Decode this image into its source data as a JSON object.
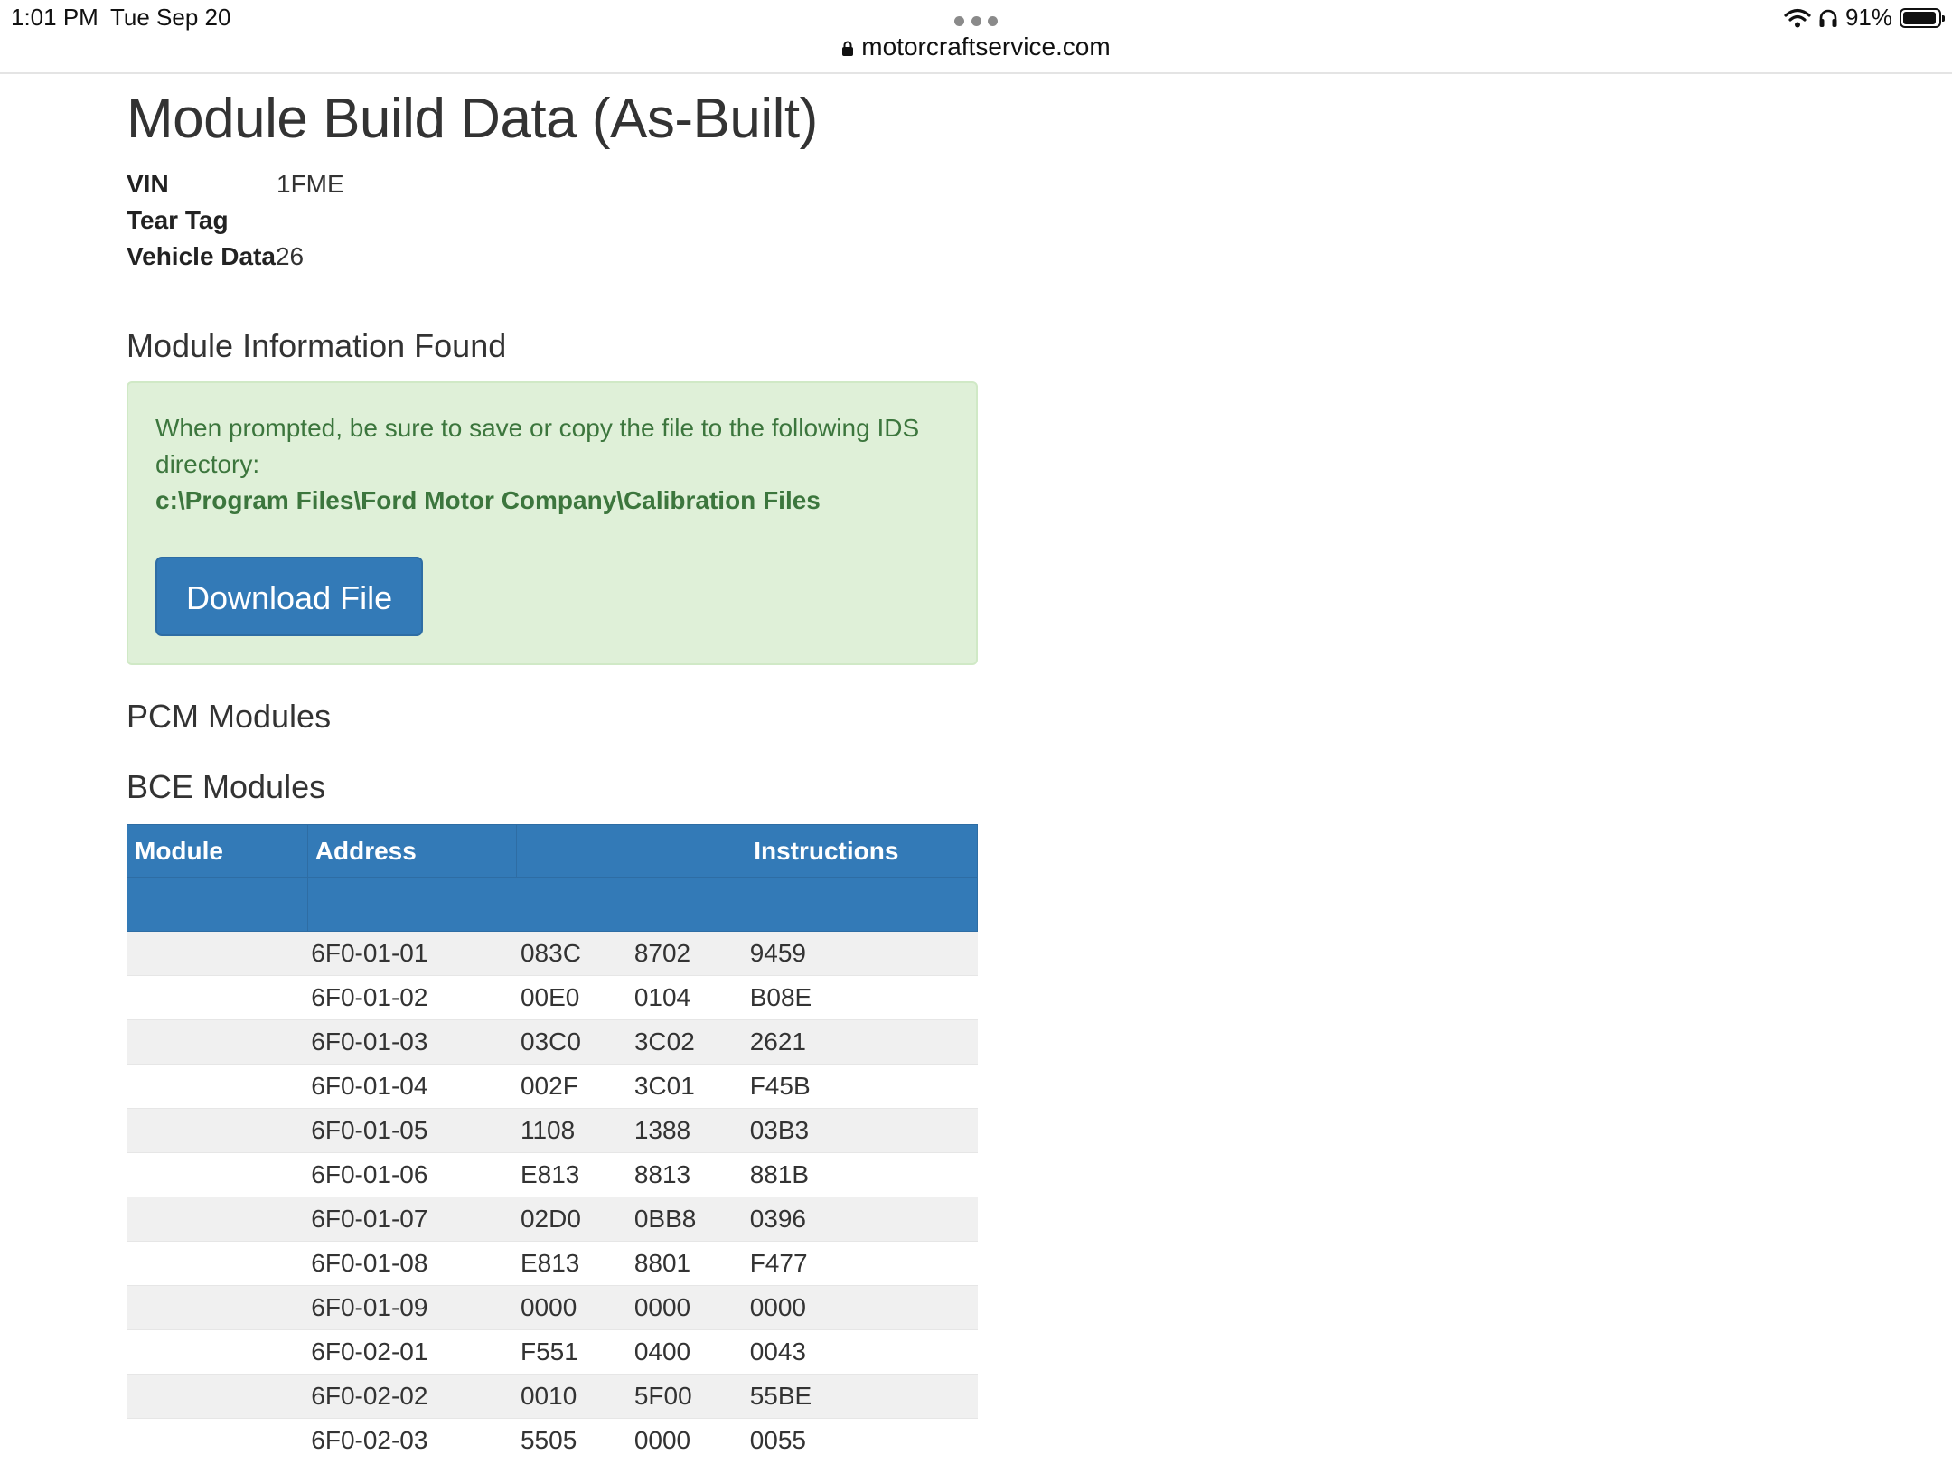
{
  "status_bar": {
    "time": "1:01 PM",
    "date": "Tue Sep 20",
    "url": "motorcraftservice.com",
    "battery": "91%",
    "icons": [
      "wifi-icon",
      "headphones-icon",
      "battery-icon",
      "lock-icon"
    ]
  },
  "page": {
    "title": "Module Build Data (As-Built)",
    "vin_label": "VIN",
    "vin_value": "1FME",
    "tear_tag_label": "Tear Tag",
    "tear_tag_value": "",
    "vehicle_data_label": "Vehicle Data",
    "vehicle_data_value": "26"
  },
  "module_info": {
    "heading": "Module Information Found",
    "message": "When prompted, be sure to save or copy the file to the following IDS directory:",
    "path": "c:\\Program Files\\Ford Motor Company\\Calibration Files",
    "download_label": "Download File"
  },
  "pcm": {
    "heading": "PCM Modules"
  },
  "bce": {
    "heading": "BCE Modules",
    "columns": [
      "Module",
      "Address",
      "",
      "Instructions"
    ],
    "rows": [
      [
        "",
        "6F0-01-01",
        "083C",
        "8702",
        "9459"
      ],
      [
        "",
        "6F0-01-02",
        "00E0",
        "0104",
        "B08E"
      ],
      [
        "",
        "6F0-01-03",
        "03C0",
        "3C02",
        "2621"
      ],
      [
        "",
        "6F0-01-04",
        "002F",
        "3C01",
        "F45B"
      ],
      [
        "",
        "6F0-01-05",
        "1108",
        "1388",
        "03B3"
      ],
      [
        "",
        "6F0-01-06",
        "E813",
        "8813",
        "881B"
      ],
      [
        "",
        "6F0-01-07",
        "02D0",
        "0BB8",
        "0396"
      ],
      [
        "",
        "6F0-01-08",
        "E813",
        "8801",
        "F477"
      ],
      [
        "",
        "6F0-01-09",
        "0000",
        "0000",
        "0000"
      ],
      [
        "",
        "6F0-02-01",
        "F551",
        "0400",
        "0043"
      ],
      [
        "",
        "6F0-02-02",
        "0010",
        "5F00",
        "55BE"
      ],
      [
        "",
        "6F0-02-03",
        "5505",
        "0000",
        "0055"
      ]
    ]
  },
  "colors": {
    "primary": "#337ab7",
    "alert_bg": "#dff0d8",
    "alert_text": "#3c763d",
    "row_stripe": "#f0f0f0"
  }
}
